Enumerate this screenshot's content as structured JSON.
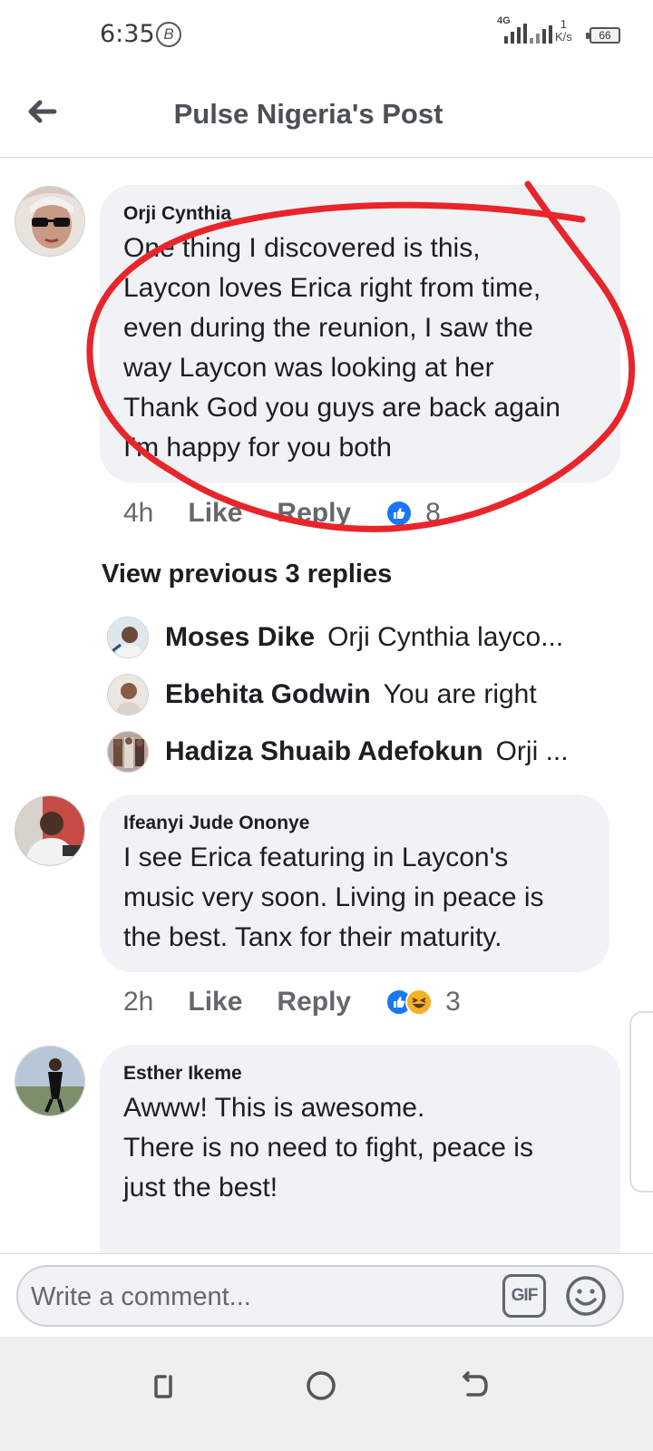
{
  "status_bar": {
    "time": "6:35",
    "b_icon": "B",
    "network": "4G",
    "speed_value": "1",
    "speed_unit": "K/s",
    "battery": "66"
  },
  "header": {
    "title": "Pulse Nigeria's Post",
    "back_icon": "arrow-left-icon"
  },
  "comments": [
    {
      "author": "Orji Cynthia",
      "text": "One thing I discovered is this,\nLaycon loves Erica right from time,\neven during the reunion, I saw the\nway Laycon was looking at her\nThank God you guys are back again\nI'm happy for you both",
      "time": "4h",
      "like_label": "Like",
      "reply_label": "Reply",
      "reaction_count": "8",
      "reactions": [
        "like"
      ]
    },
    {
      "author": "Ifeanyi Jude Ononye",
      "text": "I see Erica featuring in Laycon's\nmusic very soon. Living in peace is\nthe best. Tanx for their maturity.",
      "time": "2h",
      "like_label": "Like",
      "reply_label": "Reply",
      "reaction_count": "3",
      "reactions": [
        "like",
        "haha"
      ]
    },
    {
      "author": "Esther Ikeme",
      "text": "Awww!  This is awesome.\nThere is no need to fight, peace is\njust the best!"
    }
  ],
  "replies": {
    "view_previous_label": "View previous 3 replies",
    "items": [
      {
        "name": "Moses Dike",
        "text": "Orji Cynthia layco..."
      },
      {
        "name": "Ebehita Godwin",
        "text": "You are right"
      },
      {
        "name": "Hadiza Shuaib Adefokun",
        "text": "Orji ..."
      }
    ]
  },
  "composer": {
    "placeholder": "Write a comment...",
    "gif_label": "GIF",
    "emoji_icon": "smiley-icon"
  },
  "annotation_color": "#e8252a",
  "colors": {
    "like_blue": "#1877f2",
    "bubble_bg": "#f0f2f5",
    "muted_text": "#65676b"
  }
}
